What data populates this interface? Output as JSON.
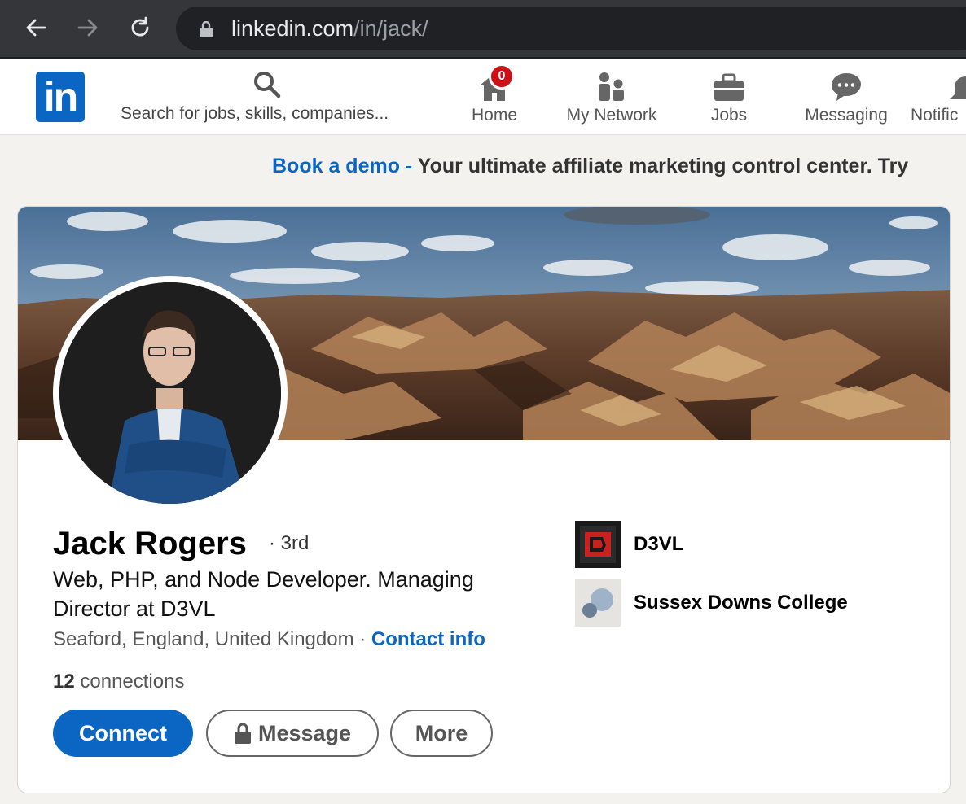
{
  "browser": {
    "url_host": "linkedin.com",
    "url_path": "/in/jack/",
    "back_icon": "arrow-left-icon",
    "forward_icon": "arrow-right-icon",
    "reload_icon": "reload-icon"
  },
  "header": {
    "logo": "in",
    "search_placeholder": "Search for jobs, skills, companies...",
    "nav": {
      "home": "Home",
      "home_badge": "0",
      "network": "My Network",
      "jobs": "Jobs",
      "messaging": "Messaging",
      "notifications": "Notific"
    }
  },
  "ad": {
    "link": "Book a demo",
    "dash": " - ",
    "text": "Your ultimate affiliate marketing control center. Try"
  },
  "profile": {
    "name": "Jack Rogers",
    "degree": "· 3rd",
    "headline": "Web, PHP, and Node Developer. Managing Director at D3VL",
    "location": "Seaford, England, United Kingdom",
    "location_sep": " · ",
    "contact_info": "Contact info",
    "connections_count": "12",
    "connections_label": " connections",
    "actions": {
      "connect": "Connect",
      "message": "Message",
      "more": "More"
    },
    "organizations": [
      {
        "name": "D3VL"
      },
      {
        "name": "Sussex Downs College"
      }
    ]
  },
  "colors": {
    "brand": "#0a66c2",
    "badge": "#cc1016",
    "page_bg": "#f3f2ef"
  }
}
